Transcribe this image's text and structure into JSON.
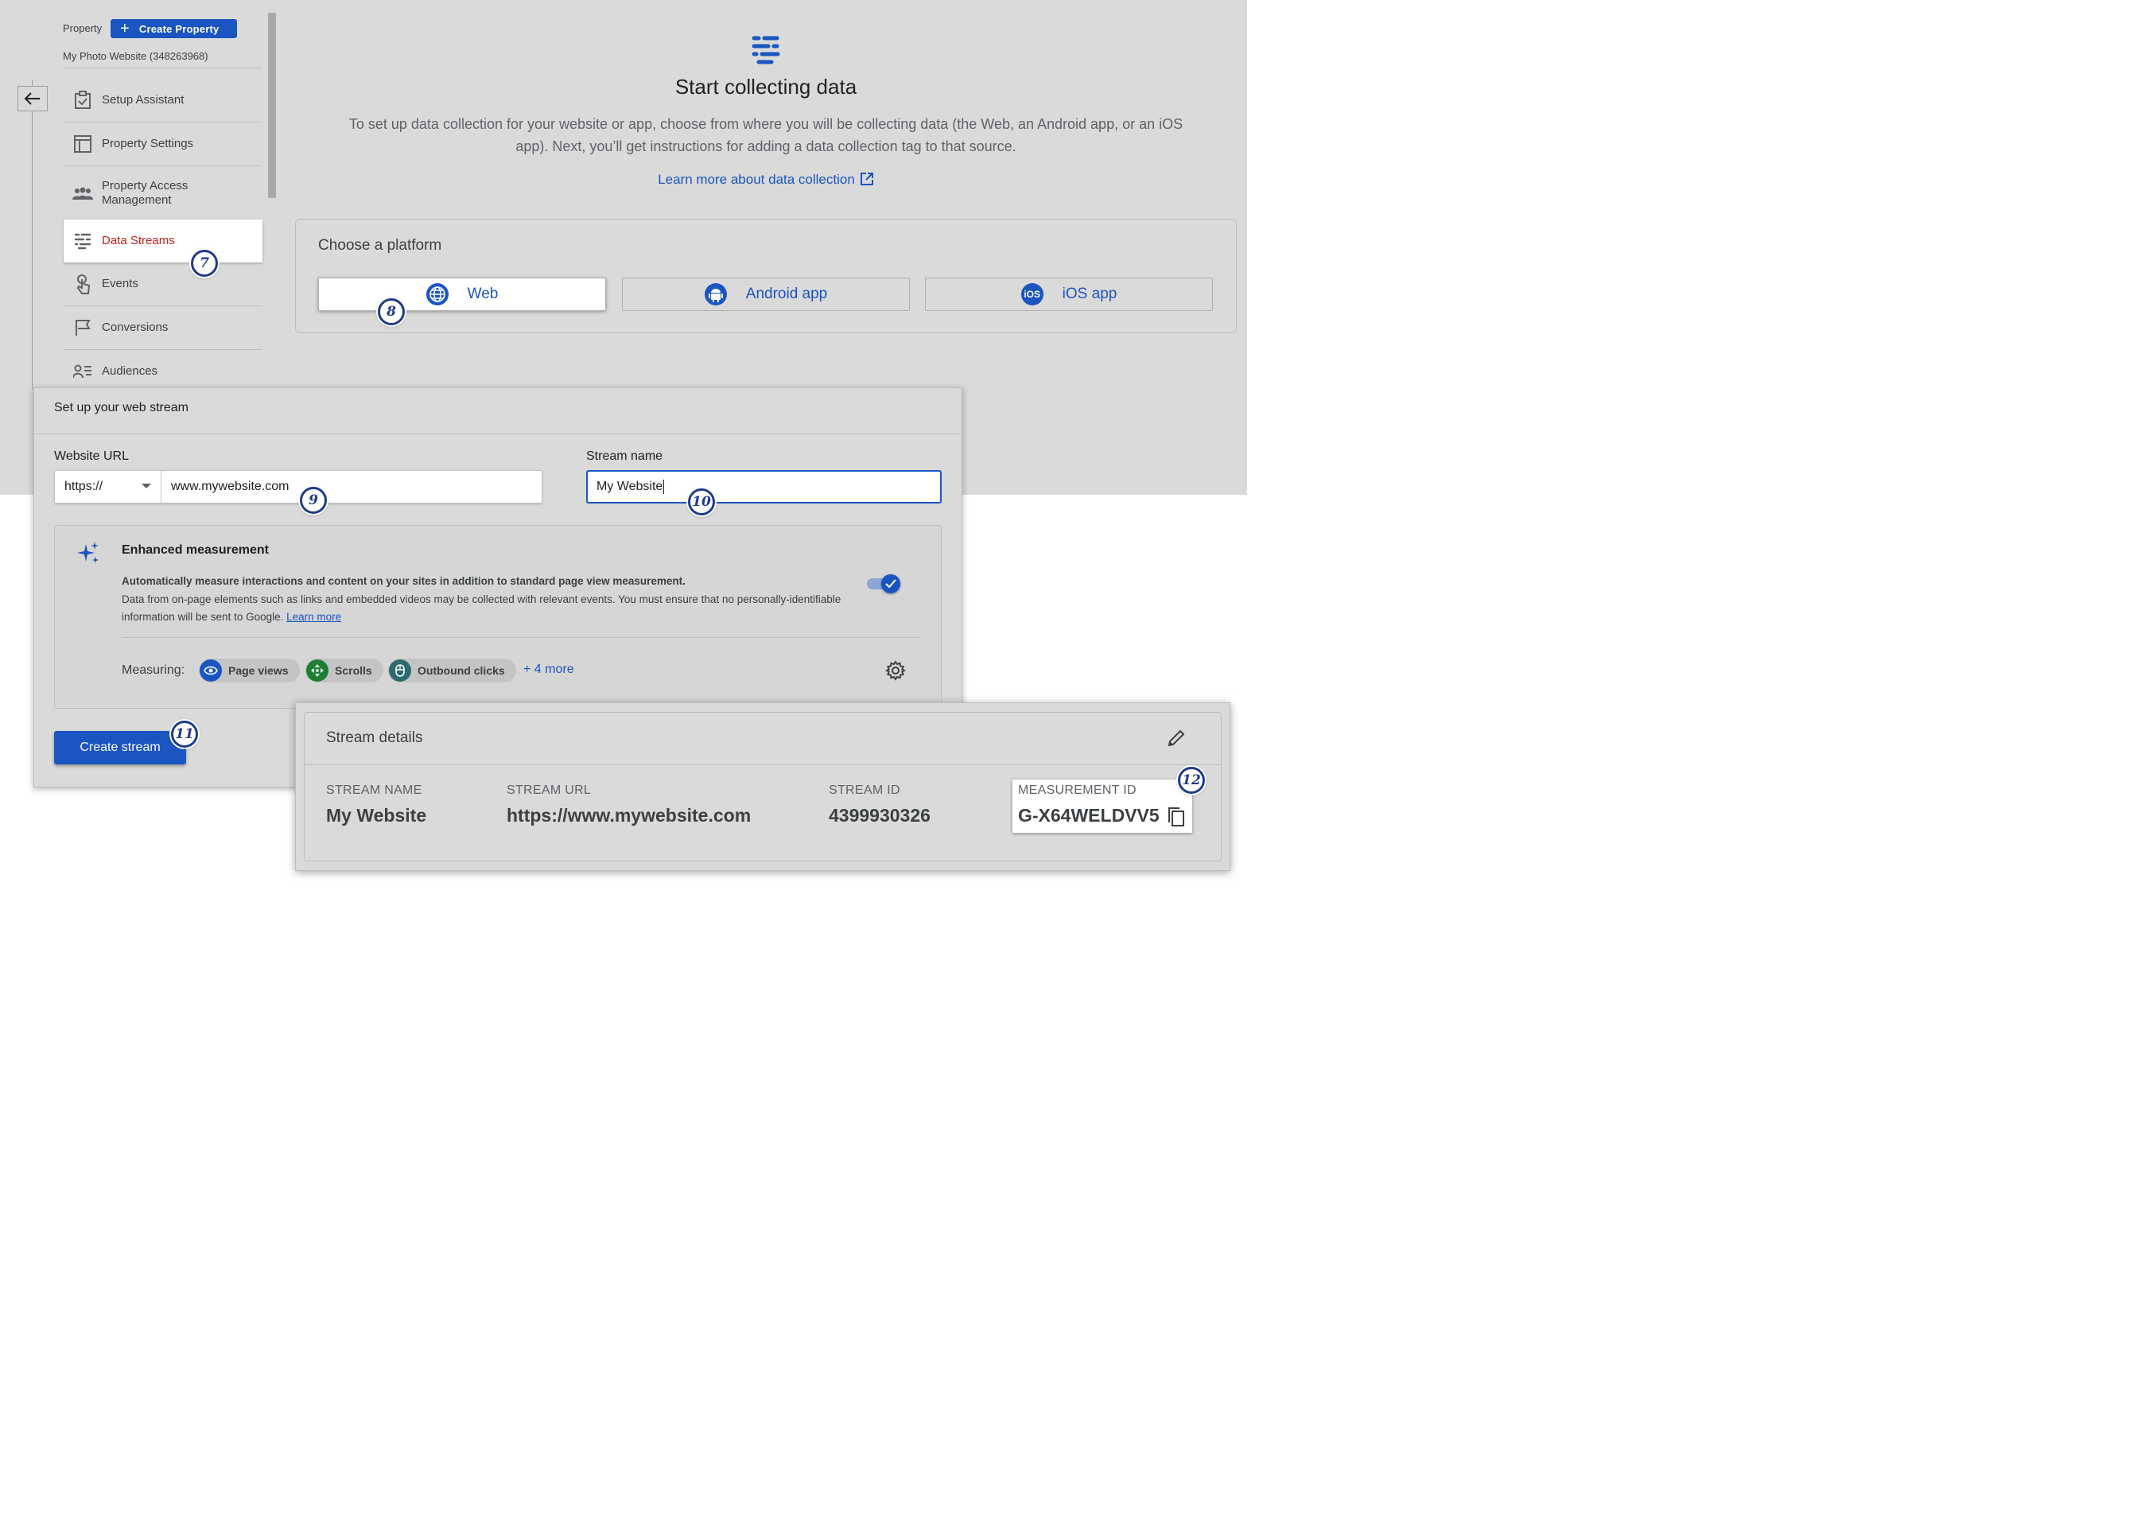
{
  "nav": {
    "property_label": "Property",
    "create_property_label": "Create Property",
    "property_name": "My Photo Website (348263968)",
    "items": [
      {
        "label": "Setup Assistant",
        "icon": "checklist-icon"
      },
      {
        "label": "Property Settings",
        "icon": "layout-icon"
      },
      {
        "label": "Property Access Management",
        "icon": "people-icon"
      },
      {
        "label": "Data Streams",
        "icon": "data-streams-icon",
        "active": true
      },
      {
        "label": "Events",
        "icon": "touch-icon"
      },
      {
        "label": "Conversions",
        "icon": "flag-icon"
      },
      {
        "label": "Audiences",
        "icon": "audience-icon"
      }
    ]
  },
  "header": {
    "title": "Start collecting data",
    "description": "To set up data collection for your website or app, choose from where you will be collecting data (the Web, an Android app, or an iOS app). Next, you’ll get instructions for adding a data collection tag to that source.",
    "learn_more": "Learn more about data collection"
  },
  "platform": {
    "title": "Choose a platform",
    "options": [
      {
        "label": "Web",
        "icon": "globe-icon",
        "selected": true
      },
      {
        "label": "Android app",
        "icon": "android-icon"
      },
      {
        "label": "iOS app",
        "icon": "ios-icon",
        "icon_text": "iOS"
      }
    ]
  },
  "setup": {
    "title": "Set up your web stream",
    "url_label": "Website URL",
    "protocol": "https://",
    "url_value": "www.mywebsite.com",
    "stream_name_label": "Stream name",
    "stream_name_value": "My Website",
    "enhanced": {
      "title": "Enhanced measurement",
      "bold_text": "Automatically measure interactions and content on your sites in addition to standard page view measurement.",
      "desc": "Data from on-page elements such as links and embedded videos may be collected with relevant events. You must ensure that no personally-identifiable information will be sent to Google.",
      "learn_more": "Learn more",
      "enabled": true,
      "measuring_label": "Measuring:",
      "chips": [
        "Page views",
        "Scrolls",
        "Outbound clicks"
      ],
      "more": "+ 4 more"
    },
    "create_button": "Create stream"
  },
  "details": {
    "title": "Stream details",
    "columns": [
      {
        "header": "STREAM NAME",
        "value": "My Website"
      },
      {
        "header": "STREAM URL",
        "value": "https://www.mywebsite.com"
      },
      {
        "header": "STREAM ID",
        "value": "4399930326"
      },
      {
        "header": "MEASUREMENT ID",
        "value": "G-X64WELDVV5"
      }
    ]
  },
  "steps": [
    "7",
    "8",
    "9",
    "10",
    "11",
    "12"
  ],
  "colors": {
    "accent": "#1a55c2",
    "active_nav": "#c5221f",
    "step_marker": "#1f3c88"
  }
}
